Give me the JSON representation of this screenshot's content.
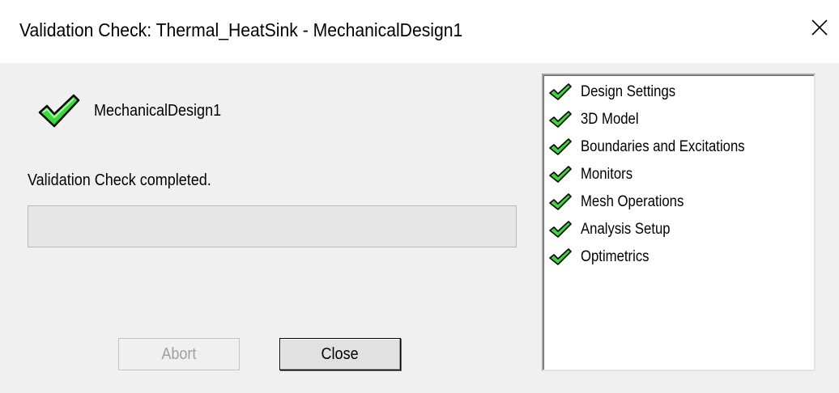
{
  "window": {
    "title": "Validation Check: Thermal_HeatSink - MechanicalDesign1"
  },
  "design": {
    "name": "MechanicalDesign1",
    "status_icon": "green-check-icon"
  },
  "status": {
    "message": "Validation Check completed."
  },
  "progress": {
    "value": 0
  },
  "buttons": {
    "abort_label": "Abort",
    "close_label": "Close"
  },
  "checks": [
    {
      "label": "Design Settings",
      "icon": "green-check-icon"
    },
    {
      "label": "3D Model",
      "icon": "green-check-icon"
    },
    {
      "label": "Boundaries and Excitations",
      "icon": "green-check-icon"
    },
    {
      "label": "Monitors",
      "icon": "green-check-icon"
    },
    {
      "label": "Mesh Operations",
      "icon": "green-check-icon"
    },
    {
      "label": "Analysis Setup",
      "icon": "green-check-icon"
    },
    {
      "label": "Optimetrics",
      "icon": "green-check-icon"
    }
  ],
  "colors": {
    "check_fill": "#33dd33",
    "check_outline": "#000000",
    "progress_fill": "#06b025"
  }
}
